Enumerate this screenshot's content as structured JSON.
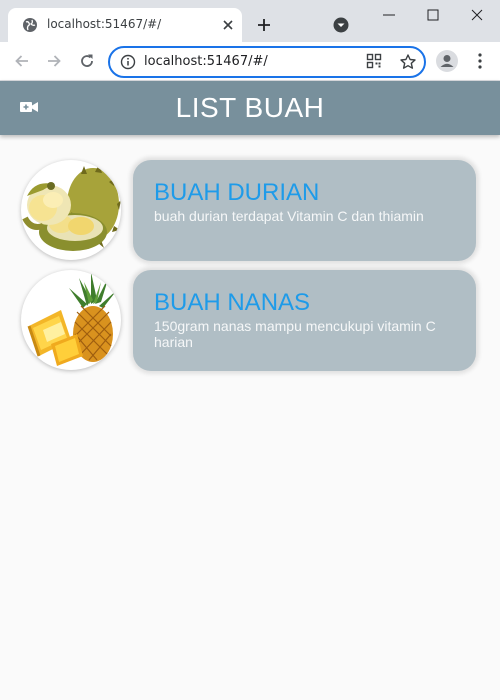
{
  "browser": {
    "tab_title": "localhost:51467/#/",
    "url": "localhost:51467/#/"
  },
  "app": {
    "title": "LIST BUAH",
    "colors": {
      "appbar": "#78909c",
      "card": "#b0bec5",
      "title_text": "#1e9be9"
    }
  },
  "items": [
    {
      "title": "BUAH DURIAN",
      "description": "buah durian terdapat Vitamin C dan thiamin",
      "image": "durian-image"
    },
    {
      "title": "BUAH NANAS",
      "description": "150gram nanas mampu mencukupi vitamin C harian",
      "image": "pineapple-image"
    }
  ]
}
